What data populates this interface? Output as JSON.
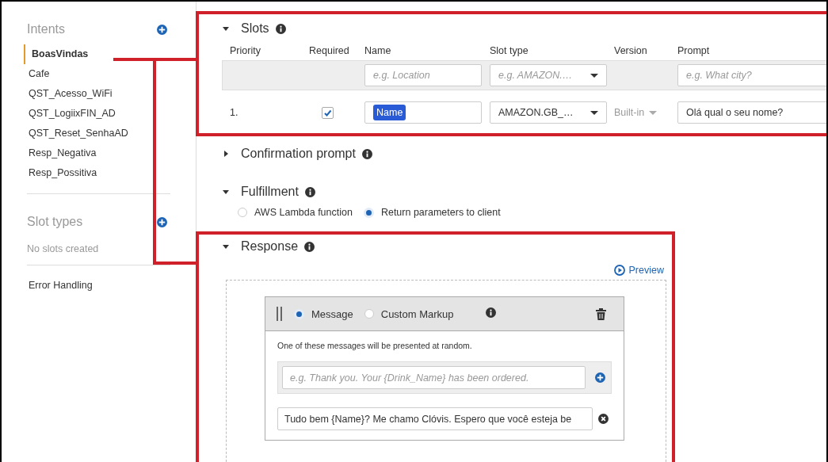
{
  "sidebar": {
    "intents": {
      "title": "Intents",
      "items": [
        {
          "label": "BoasVindas",
          "selected": true
        },
        {
          "label": "Cafe",
          "selected": false
        },
        {
          "label": "QST_Acesso_WiFi",
          "selected": false
        },
        {
          "label": "QST_LogiixFIN_AD",
          "selected": false
        },
        {
          "label": "QST_Reset_SenhaAD",
          "selected": false
        },
        {
          "label": "Resp_Negativa",
          "selected": false
        },
        {
          "label": "Resp_Possitiva",
          "selected": false
        }
      ]
    },
    "slot_types": {
      "title": "Slot types",
      "empty": "No slots created"
    },
    "error_handling": "Error Handling"
  },
  "slots": {
    "title": "Slots",
    "expanded": true,
    "columns": [
      "Priority",
      "Required",
      "Name",
      "Slot type",
      "Version",
      "Prompt"
    ],
    "new_slot": {
      "name_placeholder": "e.g. Location",
      "slot_type_placeholder": "e.g. AMAZON.…",
      "prompt_placeholder": "e.g. What city?"
    },
    "rows": [
      {
        "priority": "1.",
        "required": true,
        "name": "Name",
        "name_highlighted": true,
        "slot_type": "AMAZON.GB_…",
        "version": "Built-in",
        "prompt": "Olá qual o seu nome?"
      }
    ]
  },
  "confirmation": {
    "title": "Confirmation prompt",
    "expanded": false
  },
  "fulfillment": {
    "title": "Fulfillment",
    "expanded": true,
    "options": [
      {
        "label": "AWS Lambda function",
        "selected": false
      },
      {
        "label": "Return parameters to client",
        "selected": true
      }
    ]
  },
  "response": {
    "title": "Response",
    "expanded": true,
    "preview": "Preview",
    "card": {
      "formats": [
        {
          "label": "Message",
          "selected": true
        },
        {
          "label": "Custom Markup",
          "selected": false
        }
      ],
      "hint": "One of these messages will be presented at random.",
      "placeholder": "e.g. Thank you. Your {Drink_Name} has been ordered.",
      "messages": [
        "Tudo bem {Name}? Me chamo Clóvis. Espero que você esteja be"
      ]
    }
  }
}
